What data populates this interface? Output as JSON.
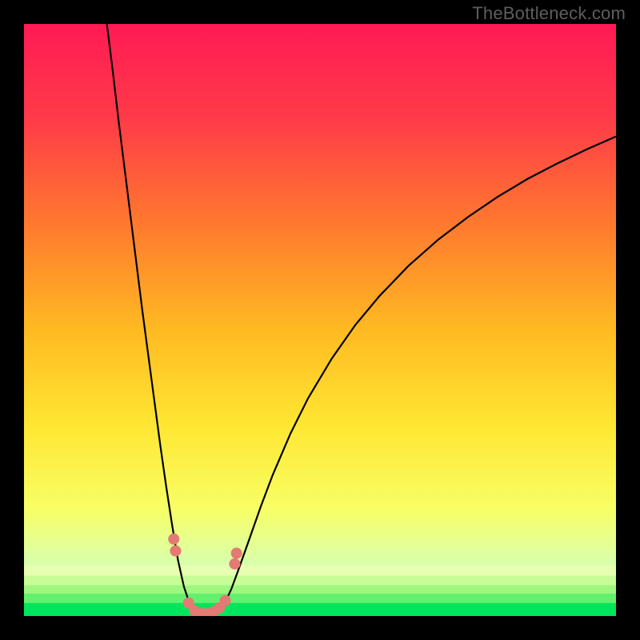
{
  "watermark": "TheBottleneck.com",
  "chart_data": {
    "type": "line",
    "title": "",
    "xlabel": "",
    "ylabel": "",
    "xlim": [
      0,
      100
    ],
    "ylim": [
      0,
      100
    ],
    "grid": false,
    "background": {
      "gradient": [
        "#ff1a55",
        "#ff5533",
        "#ffbb22",
        "#ffe733",
        "#f7ff66",
        "#d6ffb3",
        "#00e65c"
      ],
      "direction": "vertical"
    },
    "curve": {
      "style": "black",
      "width": 2.2,
      "description": "V-shaped bottleneck curve dipping to zero around x≈28–34 then rising",
      "points": [
        {
          "x": 14.0,
          "y": 100.0
        },
        {
          "x": 15.0,
          "y": 92.0
        },
        {
          "x": 16.0,
          "y": 83.5
        },
        {
          "x": 17.0,
          "y": 75.5
        },
        {
          "x": 18.0,
          "y": 67.5
        },
        {
          "x": 19.0,
          "y": 59.5
        },
        {
          "x": 20.0,
          "y": 51.5
        },
        {
          "x": 21.0,
          "y": 44.0
        },
        {
          "x": 22.0,
          "y": 36.5
        },
        {
          "x": 23.0,
          "y": 29.0
        },
        {
          "x": 24.0,
          "y": 22.0
        },
        {
          "x": 25.0,
          "y": 15.5
        },
        {
          "x": 26.0,
          "y": 9.5
        },
        {
          "x": 27.0,
          "y": 5.0
        },
        {
          "x": 28.0,
          "y": 2.0
        },
        {
          "x": 29.0,
          "y": 0.8
        },
        {
          "x": 30.0,
          "y": 0.3
        },
        {
          "x": 31.0,
          "y": 0.3
        },
        {
          "x": 32.0,
          "y": 0.6
        },
        {
          "x": 33.0,
          "y": 1.2
        },
        {
          "x": 34.0,
          "y": 2.4
        },
        {
          "x": 35.0,
          "y": 4.5
        },
        {
          "x": 36.0,
          "y": 7.2
        },
        {
          "x": 38.0,
          "y": 12.8
        },
        {
          "x": 40.0,
          "y": 18.5
        },
        {
          "x": 42.0,
          "y": 23.8
        },
        {
          "x": 45.0,
          "y": 30.8
        },
        {
          "x": 48.0,
          "y": 36.8
        },
        {
          "x": 52.0,
          "y": 43.5
        },
        {
          "x": 56.0,
          "y": 49.2
        },
        {
          "x": 60.0,
          "y": 54.0
        },
        {
          "x": 65.0,
          "y": 59.2
        },
        {
          "x": 70.0,
          "y": 63.6
        },
        {
          "x": 75.0,
          "y": 67.4
        },
        {
          "x": 80.0,
          "y": 70.8
        },
        {
          "x": 85.0,
          "y": 73.8
        },
        {
          "x": 90.0,
          "y": 76.4
        },
        {
          "x": 95.0,
          "y": 78.8
        },
        {
          "x": 100.0,
          "y": 81.0
        }
      ]
    },
    "markers": {
      "color": "#e47a74",
      "radius_data_units": 0.95,
      "points": [
        {
          "x": 25.3,
          "y": 13.0
        },
        {
          "x": 25.6,
          "y": 11.0
        },
        {
          "x": 27.8,
          "y": 2.2
        },
        {
          "x": 28.8,
          "y": 0.9
        },
        {
          "x": 30.0,
          "y": 0.4
        },
        {
          "x": 31.0,
          "y": 0.4
        },
        {
          "x": 32.0,
          "y": 0.7
        },
        {
          "x": 33.0,
          "y": 1.4
        },
        {
          "x": 34.0,
          "y": 2.6
        },
        {
          "x": 35.6,
          "y": 8.8
        },
        {
          "x": 35.9,
          "y": 10.6
        }
      ]
    },
    "bottom_bands": [
      {
        "y0": 0.0,
        "y1": 2.2,
        "color": "#00e65c"
      },
      {
        "y0": 2.2,
        "y1": 3.8,
        "color": "#63f06e"
      },
      {
        "y0": 3.8,
        "y1": 5.2,
        "color": "#9ef77f"
      },
      {
        "y0": 5.2,
        "y1": 6.8,
        "color": "#c8fc96"
      },
      {
        "y0": 6.8,
        "y1": 8.6,
        "color": "#e6ffb0"
      }
    ]
  },
  "colors": {
    "frame": "#000000",
    "curve": "#000000",
    "marker": "#e47a74"
  }
}
